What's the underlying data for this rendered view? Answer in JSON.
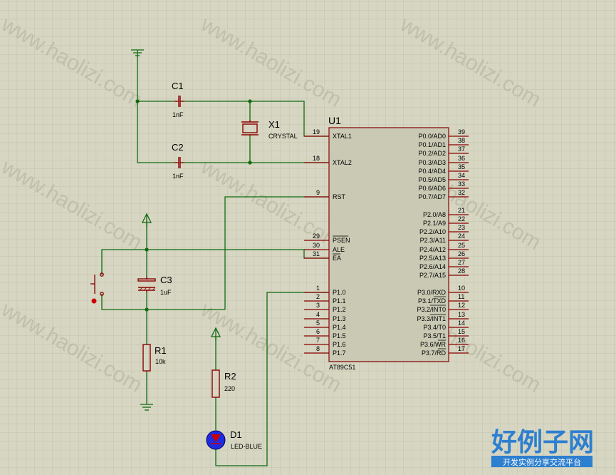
{
  "colors": {
    "background": "#d6d6c2",
    "grid": "#c2c2ac",
    "wire": "#106a10",
    "component": "#8b0000",
    "chip_fill": "#c9c9b4",
    "pin": "#8b0000",
    "text": "#000000",
    "led": "#1e2be0",
    "watermark": "#b9b9a4",
    "logo_blue": "#2d7fd0"
  },
  "watermark": "www.haolizi.com",
  "logo": {
    "title": "好例子网",
    "subtitle": "开发实例分享交流平台"
  },
  "components": {
    "c1": {
      "ref": "C1",
      "value": "1nF"
    },
    "c2": {
      "ref": "C2",
      "value": "1nF"
    },
    "x1": {
      "ref": "X1",
      "value": "CRYSTAL"
    },
    "c3": {
      "ref": "C3",
      "value": "1uF"
    },
    "r1": {
      "ref": "R1",
      "value": "10k"
    },
    "r2": {
      "ref": "R2",
      "value": "220"
    },
    "d1": {
      "ref": "D1",
      "value": "LED-BLUE"
    }
  },
  "chip": {
    "ref": "U1",
    "part": "AT89C51",
    "left_pins": [
      {
        "num": "19",
        "name": "XTAL1"
      },
      {
        "num": "18",
        "name": "XTAL2"
      },
      {
        "num": "9",
        "name": "RST"
      },
      {
        "num": "29",
        "name": "PSEN"
      },
      {
        "num": "30",
        "name": "ALE"
      },
      {
        "num": "31",
        "name": "EA"
      },
      {
        "num": "1",
        "name": "P1.0"
      },
      {
        "num": "2",
        "name": "P1.1"
      },
      {
        "num": "3",
        "name": "P1.2"
      },
      {
        "num": "4",
        "name": "P1.3"
      },
      {
        "num": "5",
        "name": "P1.4"
      },
      {
        "num": "6",
        "name": "P1.5"
      },
      {
        "num": "7",
        "name": "P1.6"
      },
      {
        "num": "8",
        "name": "P1.7"
      }
    ],
    "right_pins": [
      {
        "num": "39",
        "name": "P0.0/AD0"
      },
      {
        "num": "38",
        "name": "P0.1/AD1"
      },
      {
        "num": "37",
        "name": "P0.2/AD2"
      },
      {
        "num": "36",
        "name": "P0.3/AD3"
      },
      {
        "num": "35",
        "name": "P0.4/AD4"
      },
      {
        "num": "34",
        "name": "P0.5/AD5"
      },
      {
        "num": "33",
        "name": "P0.6/AD6"
      },
      {
        "num": "32",
        "name": "P0.7/AD7"
      },
      {
        "num": "21",
        "name": "P2.0/A8"
      },
      {
        "num": "22",
        "name": "P2.1/A9"
      },
      {
        "num": "23",
        "name": "P2.2/A10"
      },
      {
        "num": "24",
        "name": "P2.3/A11"
      },
      {
        "num": "25",
        "name": "P2.4/A12"
      },
      {
        "num": "26",
        "name": "P2.5/A13"
      },
      {
        "num": "27",
        "name": "P2.6/A14"
      },
      {
        "num": "28",
        "name": "P2.7/A15"
      },
      {
        "num": "10",
        "name": "P3.0/RXD"
      },
      {
        "num": "11",
        "name": "P3.1/TXD"
      },
      {
        "num": "12",
        "name": "P3.2/INT0"
      },
      {
        "num": "13",
        "name": "P3.3/INT1"
      },
      {
        "num": "14",
        "name": "P3.4/T0"
      },
      {
        "num": "15",
        "name": "P3.5/T1"
      },
      {
        "num": "16",
        "name": "P3.6/WR"
      },
      {
        "num": "17",
        "name": "P3.7/RD"
      }
    ]
  }
}
